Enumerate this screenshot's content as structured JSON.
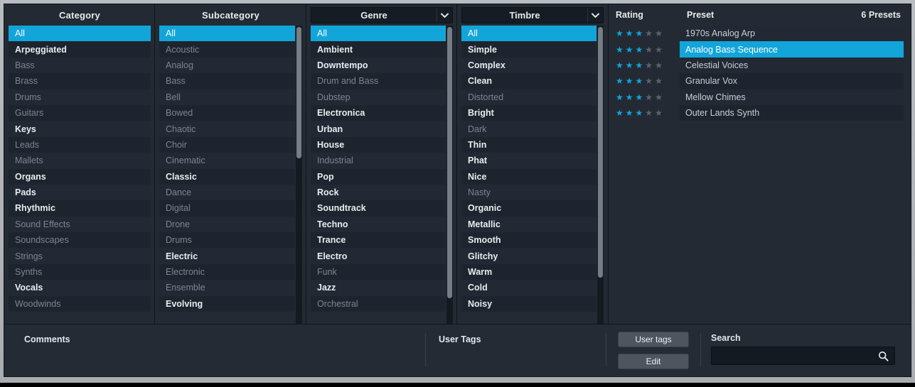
{
  "columns": {
    "category": {
      "header": "Category",
      "has_dropdown": false,
      "scrollbar": false,
      "items": [
        {
          "label": "All",
          "state": "selected"
        },
        {
          "label": "Arpeggiated",
          "state": "active"
        },
        {
          "label": "Bass",
          "state": "dim"
        },
        {
          "label": "Brass",
          "state": "dim"
        },
        {
          "label": "Drums",
          "state": "dim"
        },
        {
          "label": "Guitars",
          "state": "dim"
        },
        {
          "label": "Keys",
          "state": "active"
        },
        {
          "label": "Leads",
          "state": "dim"
        },
        {
          "label": "Mallets",
          "state": "dim"
        },
        {
          "label": "Organs",
          "state": "active"
        },
        {
          "label": "Pads",
          "state": "active"
        },
        {
          "label": "Rhythmic",
          "state": "active"
        },
        {
          "label": "Sound Effects",
          "state": "dim"
        },
        {
          "label": "Soundscapes",
          "state": "dim"
        },
        {
          "label": "Strings",
          "state": "dim"
        },
        {
          "label": "Synths",
          "state": "dim"
        },
        {
          "label": "Vocals",
          "state": "active"
        },
        {
          "label": "Woodwinds",
          "state": "dim"
        }
      ]
    },
    "subcategory": {
      "header": "Subcategory",
      "has_dropdown": false,
      "scrollbar": true,
      "scroll_thumb_pct": 45,
      "items": [
        {
          "label": "All",
          "state": "selected"
        },
        {
          "label": "Acoustic",
          "state": "dim"
        },
        {
          "label": "Analog",
          "state": "dim"
        },
        {
          "label": "Bass",
          "state": "dim"
        },
        {
          "label": "Bell",
          "state": "dim"
        },
        {
          "label": "Bowed",
          "state": "dim"
        },
        {
          "label": "Chaotic",
          "state": "dim"
        },
        {
          "label": "Choir",
          "state": "dim"
        },
        {
          "label": "Cinematic",
          "state": "dim"
        },
        {
          "label": "Classic",
          "state": "active"
        },
        {
          "label": "Dance",
          "state": "dim"
        },
        {
          "label": "Digital",
          "state": "dim"
        },
        {
          "label": "Drone",
          "state": "dim"
        },
        {
          "label": "Drums",
          "state": "dim"
        },
        {
          "label": "Electric",
          "state": "active"
        },
        {
          "label": "Electronic",
          "state": "dim"
        },
        {
          "label": "Ensemble",
          "state": "dim"
        },
        {
          "label": "Evolving",
          "state": "active"
        }
      ]
    },
    "genre": {
      "header": "Genre",
      "has_dropdown": true,
      "scrollbar": true,
      "scroll_thumb_pct": 92,
      "items": [
        {
          "label": "All",
          "state": "selected"
        },
        {
          "label": "Ambient",
          "state": "active"
        },
        {
          "label": "Downtempo",
          "state": "active"
        },
        {
          "label": "Drum and Bass",
          "state": "dim"
        },
        {
          "label": "Dubstep",
          "state": "dim"
        },
        {
          "label": "Electronica",
          "state": "active"
        },
        {
          "label": "Urban",
          "state": "active"
        },
        {
          "label": "House",
          "state": "active"
        },
        {
          "label": "Industrial",
          "state": "dim"
        },
        {
          "label": "Pop",
          "state": "active"
        },
        {
          "label": "Rock",
          "state": "active"
        },
        {
          "label": "Soundtrack",
          "state": "active"
        },
        {
          "label": "Techno",
          "state": "active"
        },
        {
          "label": "Trance",
          "state": "active"
        },
        {
          "label": "Electro",
          "state": "active"
        },
        {
          "label": "Funk",
          "state": "dim"
        },
        {
          "label": "Jazz",
          "state": "active"
        },
        {
          "label": "Orchestral",
          "state": "dim"
        }
      ]
    },
    "timbre": {
      "header": "Timbre",
      "has_dropdown": true,
      "scrollbar": true,
      "scroll_thumb_pct": 85,
      "items": [
        {
          "label": "All",
          "state": "selected"
        },
        {
          "label": "Simple",
          "state": "active"
        },
        {
          "label": "Complex",
          "state": "active"
        },
        {
          "label": "Clean",
          "state": "active"
        },
        {
          "label": "Distorted",
          "state": "dim"
        },
        {
          "label": "Bright",
          "state": "active"
        },
        {
          "label": "Dark",
          "state": "dim"
        },
        {
          "label": "Thin",
          "state": "active"
        },
        {
          "label": "Phat",
          "state": "active"
        },
        {
          "label": "Nice",
          "state": "active"
        },
        {
          "label": "Nasty",
          "state": "dim"
        },
        {
          "label": "Organic",
          "state": "active"
        },
        {
          "label": "Metallic",
          "state": "active"
        },
        {
          "label": "Smooth",
          "state": "active"
        },
        {
          "label": "Glitchy",
          "state": "active"
        },
        {
          "label": "Warm",
          "state": "active"
        },
        {
          "label": "Cold",
          "state": "active"
        },
        {
          "label": "Noisy",
          "state": "active"
        }
      ]
    }
  },
  "presets": {
    "header": {
      "rating": "Rating",
      "preset": "Preset",
      "count": "6 Presets"
    },
    "max_stars": 5,
    "rows": [
      {
        "name": "1970s Analog Arp",
        "rating": 3,
        "selected": false
      },
      {
        "name": "Analog Bass Sequence",
        "rating": 3,
        "selected": true
      },
      {
        "name": "Celestial Voices",
        "rating": 3,
        "selected": false
      },
      {
        "name": "Granular Vox",
        "rating": 3,
        "selected": false
      },
      {
        "name": "Mellow Chimes",
        "rating": 3,
        "selected": false
      },
      {
        "name": "Outer Lands Synth",
        "rating": 3,
        "selected": false
      }
    ]
  },
  "bottom": {
    "comments_label": "Comments",
    "comments_value": "",
    "user_tags_label": "User Tags",
    "user_tags_value": "",
    "user_tags_button": "User tags",
    "edit_button": "Edit",
    "search_label": "Search",
    "search_value": "",
    "search_placeholder": ""
  },
  "colors": {
    "accent": "#12a5d9",
    "panel_bg": "#232a33",
    "row_bg": "#222934",
    "row_alt_bg": "#1e242d",
    "text_active": "#e9ecef",
    "text_dim": "#7d858f",
    "frame": "#b9bcc0"
  }
}
